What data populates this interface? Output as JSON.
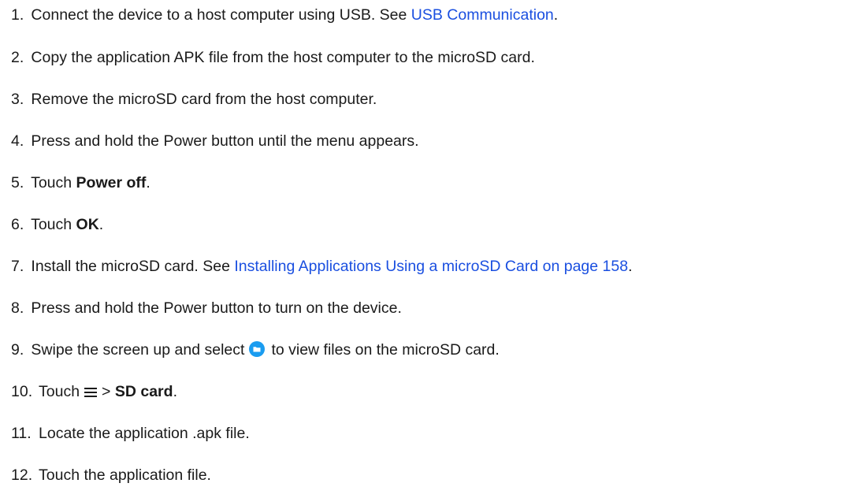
{
  "steps": [
    {
      "number": "1.",
      "text": "Connect the device to a host computer using USB. See ",
      "link": "USB Communication",
      "after": "."
    },
    {
      "number": "2.",
      "text": "Copy the application APK file from the host computer to the microSD card."
    },
    {
      "number": "3.",
      "text": "Remove the microSD card from the host computer."
    },
    {
      "number": "4.",
      "text": "Press and hold the Power button until the menu appears."
    },
    {
      "number": "5.",
      "text": "Touch ",
      "bold": "Power off",
      "after": "."
    },
    {
      "number": "6.",
      "text": "Touch ",
      "bold": "OK",
      "after": "."
    },
    {
      "number": "7.",
      "text": "Install the microSD card. See ",
      "link": "Installing Applications Using a microSD Card on page 158",
      "after": "."
    },
    {
      "number": "8.",
      "text": "Press and hold the Power button to turn on the device."
    },
    {
      "number": "9.",
      "text": "Swipe the screen up and select",
      "after": "to view files on the microSD card."
    },
    {
      "number": "10.",
      "text": "Touch",
      "middle": ">",
      "bold": "SD card",
      "after": "."
    },
    {
      "number": "11.",
      "text": "Locate the application .apk file."
    },
    {
      "number": "12.",
      "text": "Touch the application file."
    }
  ],
  "icons": {
    "files_app": "files-app-icon",
    "menu": "hamburger-menu-icon"
  },
  "colors": {
    "link": "#1a4fe0",
    "files_icon": "#1a9cf0"
  }
}
